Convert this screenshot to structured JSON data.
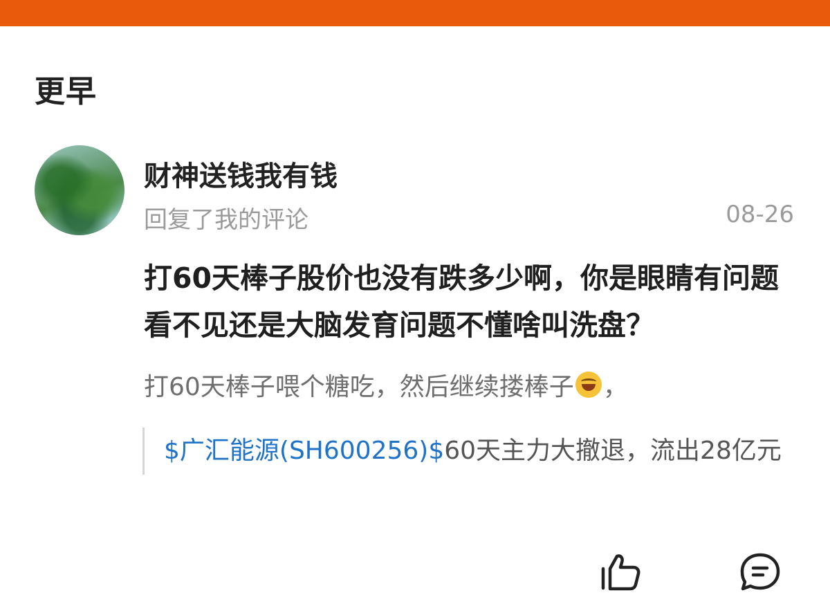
{
  "section": {
    "title": "更早"
  },
  "notification": {
    "username": "财神送钱我有钱",
    "action": "回复了我的评论",
    "date": "08-26",
    "reply": "打60天棒子股价也没有跌多少啊，你是眼睛有问题看不见还是大脑发育问题不懂啥叫洗盘？",
    "my_comment": "打60天棒子喂个糖吃，然后继续搂棒子",
    "my_comment_tail": "，",
    "emoji_icon": "laughing-tears-emoji",
    "quote": {
      "stock_link": "$广汇能源(SH600256)$",
      "text": "60天主力大撤退，流出28亿元"
    }
  },
  "actions": {
    "like_icon": "thumbs-up-icon",
    "comment_icon": "comment-bubble-icon"
  },
  "colors": {
    "topbar": "#e95a0c",
    "link": "#1e72c8",
    "muted": "#9a9a9a"
  }
}
